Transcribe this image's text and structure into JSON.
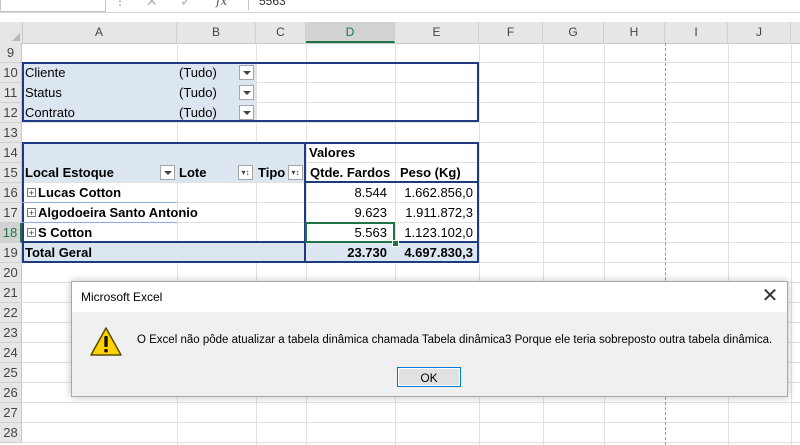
{
  "formula_bar": {
    "fx": "fx",
    "cell_value": "5563"
  },
  "columns": [
    "A",
    "B",
    "C",
    "D",
    "E",
    "F",
    "G",
    "H",
    "I",
    "J"
  ],
  "rows": [
    "9",
    "10",
    "11",
    "12",
    "13",
    "14",
    "15",
    "16",
    "17",
    "18",
    "19",
    "20",
    "21",
    "22",
    "23",
    "24",
    "25",
    "26",
    "27",
    "28"
  ],
  "filters": [
    {
      "label": "Cliente",
      "value": "(Tudo)"
    },
    {
      "label": "Status",
      "value": "(Tudo)"
    },
    {
      "label": "Contrato",
      "value": "(Tudo)"
    }
  ],
  "pivot": {
    "values_label": "Valores",
    "headers": {
      "local": "Local Estoque",
      "lote": "Lote",
      "tipo": "Tipo",
      "qtde": "Qtde. Fardos",
      "peso": "Peso (Kg)"
    },
    "rows": [
      {
        "name": "Lucas Cotton",
        "qtde": "8.544",
        "peso": "1.662.856,0"
      },
      {
        "name": "Algodoeira Santo Antonio",
        "qtde": "9.623",
        "peso": "1.911.872,3"
      },
      {
        "name": "S Cotton",
        "qtde": "5.563",
        "peso": "1.123.102,0"
      }
    ],
    "total": {
      "label": "Total Geral",
      "qtde": "23.730",
      "peso": "4.697.830,3"
    }
  },
  "dialog": {
    "title": "Microsoft Excel",
    "message": "O Excel não pôde atualizar a tabela dinâmica chamada Tabela dinâmica3 Porque ele teria sobreposto outra tabela dinâmica.",
    "ok_label": "OK"
  }
}
